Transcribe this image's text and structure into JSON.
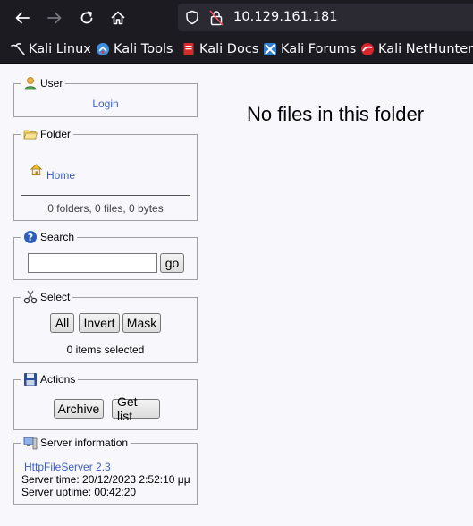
{
  "browser": {
    "url": "10.129.161.181",
    "bookmarks": [
      {
        "label": "Kali Linux",
        "icon": "kali-dragon-icon"
      },
      {
        "label": "Kali Tools",
        "icon": "kali-tools-icon"
      },
      {
        "label": "Kali Docs",
        "icon": "kali-docs-icon"
      },
      {
        "label": "Kali Forums",
        "icon": "kali-forums-icon"
      },
      {
        "label": "Kali NetHunter",
        "icon": "kali-nethunter-icon"
      }
    ]
  },
  "sidebar": {
    "user": {
      "legend": "User",
      "login_label": "Login"
    },
    "folder": {
      "legend": "Folder",
      "home_label": "Home",
      "summary": "0 folders, 0 files, 0 bytes"
    },
    "search": {
      "legend": "Search",
      "query": "",
      "go_label": "go"
    },
    "select": {
      "legend": "Select",
      "all_label": "All",
      "invert_label": "Invert",
      "mask_label": "Mask",
      "status": "0 items selected"
    },
    "actions": {
      "legend": "Actions",
      "archive_label": "Archive",
      "getlist_label": "Get list"
    },
    "server_info": {
      "legend": "Server information",
      "software_link": "HttpFileServer 2.3",
      "server_time": "Server time: 20/12/2023 2:52:10 μμ",
      "server_uptime": "Server uptime: 00:42:20"
    }
  },
  "main": {
    "message": "No files in this folder"
  },
  "colors": {
    "link": "#3b5fcf",
    "chrome": "#1c1b22",
    "urlbar": "#2b2a33"
  }
}
